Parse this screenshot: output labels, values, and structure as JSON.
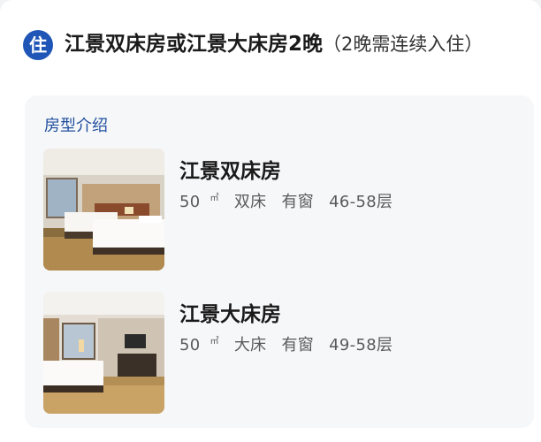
{
  "header": {
    "badge": "住",
    "title": "江景双床房或江景大床房2晚",
    "note": "（2晚需连续入住）"
  },
  "section": {
    "label": "房型介绍"
  },
  "rooms": [
    {
      "name": "江景双床房",
      "area": "50",
      "area_unit": "㎡",
      "bed": "双床",
      "window": "有窗",
      "floors": "46-58层"
    },
    {
      "name": "江景大床房",
      "area": "50",
      "area_unit": "㎡",
      "bed": "大床",
      "window": "有窗",
      "floors": "49-58层"
    }
  ],
  "colors": {
    "accent": "#1f55b6",
    "section_label": "#1f4f9e"
  }
}
